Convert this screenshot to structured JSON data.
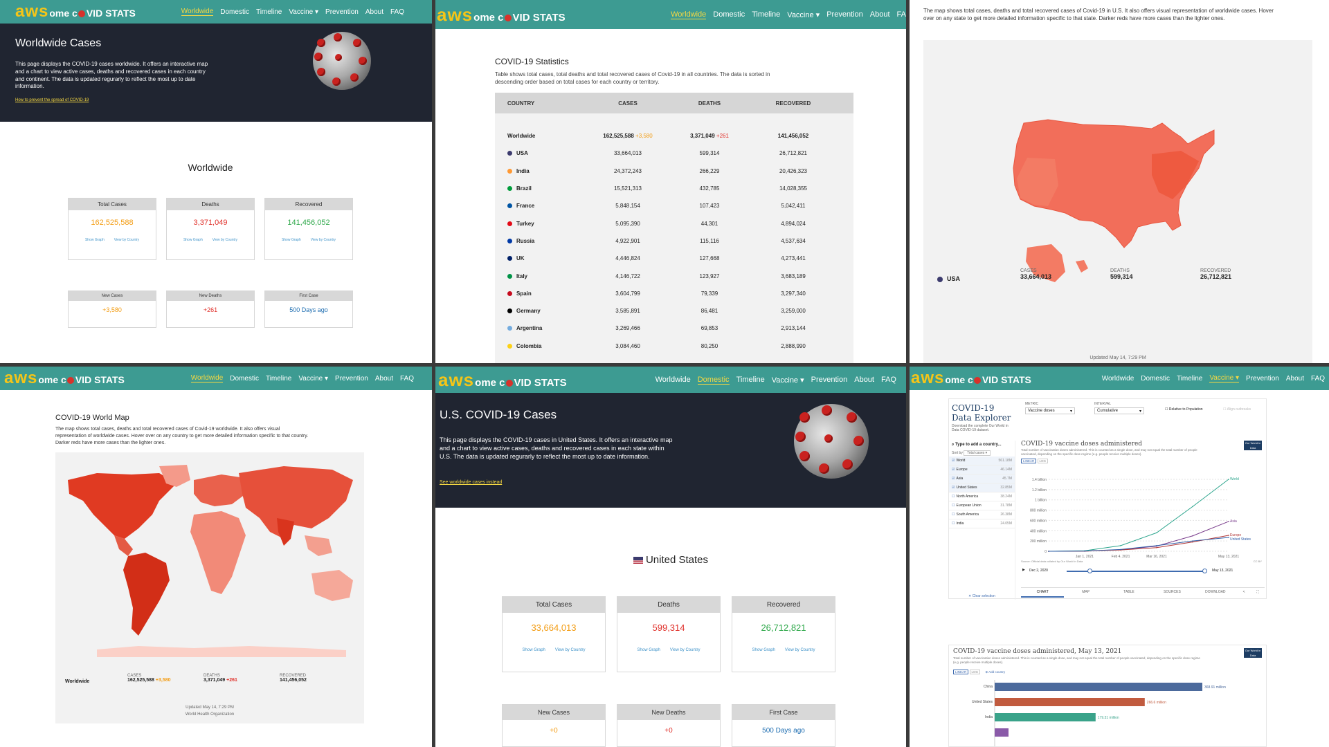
{
  "brand": {
    "aws": "aws",
    "rest_a": "ome c",
    "rest_b": "VID STATS"
  },
  "nav": {
    "worldwide": "Worldwide",
    "domestic": "Domestic",
    "timeline": "Timeline",
    "vaccine": "Vaccine",
    "prevention": "Prevention",
    "about": "About",
    "faq": "FAQ",
    "faq_cut": "FA"
  },
  "p1": {
    "title": "Worldwide Cases",
    "desc": "This page displays the COVID-19 cases worldwide. It offers an interactive map and a chart to view active cases, deaths and recovered cases in each country and continent. The data is updated regurarly to reflect the most up to date information.",
    "link": "How to prevent the spread of COVID-19",
    "section": "Worldwide",
    "cards": [
      {
        "label": "Total Cases",
        "value": "162,525,588",
        "color": "#f39c12"
      },
      {
        "label": "Deaths",
        "value": "3,371,049",
        "color": "#e0302a"
      },
      {
        "label": "Recovered",
        "value": "141,456,052",
        "color": "#2ea84a"
      }
    ],
    "show_graph": "Show Graph",
    "view_by_country": "View by Country",
    "small": [
      {
        "label": "New Cases",
        "value": "+3,580",
        "color": "#f39c12"
      },
      {
        "label": "New Deaths",
        "value": "+261",
        "color": "#e0302a"
      },
      {
        "label": "First Case",
        "value": "500 Days ago",
        "color": "#1c6cb0"
      }
    ]
  },
  "p2": {
    "title": "COVID-19 Statistics",
    "desc": "Table shows total cases, total deaths and total recovered cases of Covid-19 in all countries. The data is sorted in descending order based on total cases for each country or territory.",
    "headers": [
      "COUNTRY",
      "CASES",
      "DEATHS",
      "RECOVERED"
    ],
    "rows": [
      {
        "country": "Worldwide",
        "cases": "162,525,588",
        "cases_new": "+3,580",
        "deaths": "3,371,049",
        "deaths_new": "+261",
        "recovered": "141,456,052",
        "flag": ""
      },
      {
        "country": "USA",
        "cases": "33,664,013",
        "deaths": "599,314",
        "recovered": "26,712,821",
        "flag": "#3c3b6e"
      },
      {
        "country": "India",
        "cases": "24,372,243",
        "deaths": "266,229",
        "recovered": "20,426,323",
        "flag": "#ff9933"
      },
      {
        "country": "Brazil",
        "cases": "15,521,313",
        "deaths": "432,785",
        "recovered": "14,028,355",
        "flag": "#009c3b"
      },
      {
        "country": "France",
        "cases": "5,848,154",
        "deaths": "107,423",
        "recovered": "5,042,411",
        "flag": "#0055a4"
      },
      {
        "country": "Turkey",
        "cases": "5,095,390",
        "deaths": "44,301",
        "recovered": "4,894,024",
        "flag": "#e30a17"
      },
      {
        "country": "Russia",
        "cases": "4,922,901",
        "deaths": "115,116",
        "recovered": "4,537,634",
        "flag": "#0039a6"
      },
      {
        "country": "UK",
        "cases": "4,446,824",
        "deaths": "127,668",
        "recovered": "4,273,441",
        "flag": "#012169"
      },
      {
        "country": "Italy",
        "cases": "4,146,722",
        "deaths": "123,927",
        "recovered": "3,683,189",
        "flag": "#009246"
      },
      {
        "country": "Spain",
        "cases": "3,604,799",
        "deaths": "79,339",
        "recovered": "3,297,340",
        "flag": "#c60b1e"
      },
      {
        "country": "Germany",
        "cases": "3,585,891",
        "deaths": "86,481",
        "recovered": "3,259,000",
        "flag": "#000000"
      },
      {
        "country": "Argentina",
        "cases": "3,269,466",
        "deaths": "69,853",
        "recovered": "2,913,144",
        "flag": "#74acdf"
      },
      {
        "country": "Colombia",
        "cases": "3,084,460",
        "deaths": "80,250",
        "recovered": "2,888,990",
        "flag": "#fcd116"
      }
    ]
  },
  "p3": {
    "desc": "The map shows total cases, deaths and total recovered cases of Covid-19 in U.S. It also offers visual representation of worldwide cases. Hover over on any state to get more detailed information specific to that state. Darker reds have more cases than the lighter ones.",
    "country": "USA",
    "cases_label": "CASES",
    "cases": "33,664,013",
    "deaths_label": "DEATHS",
    "deaths": "599,314",
    "recovered_label": "RECOVERED",
    "recovered": "26,712,821",
    "updated": "Updated May 14, 7:29 PM"
  },
  "p4": {
    "title": "COVID-19 World Map",
    "desc": "The map shows total cases, deaths and total recovered cases of Covid-19 worldwide. It also offers visual representation of worldwide cases. Hover over on any country to get more detailed information specific to that country. Darker reds have more cases than the lighter ones.",
    "country": "Worldwide",
    "cases_label": "CASES",
    "cases": "162,525,588",
    "cases_new": "+3,580",
    "deaths_label": "DEATHS",
    "deaths": "3,371,049",
    "deaths_new": "+261",
    "recovered_label": "RECOVERED",
    "recovered": "141,456,052",
    "updated": "Updated May 14, 7:29 PM",
    "source": "World Health Organization"
  },
  "p5": {
    "title": "U.S. COVID-19 Cases",
    "desc": "This page displays the COVID-19 cases in United States. It offers an interactive map and a chart to view active cases, deaths and recovered cases in each state within U.S. The data is updated regurarly to reflect the most up to date information.",
    "link": "See worldwide cases instead",
    "section": "United States",
    "cards": [
      {
        "label": "Total Cases",
        "value": "33,664,013",
        "color": "#f39c12"
      },
      {
        "label": "Deaths",
        "value": "599,314",
        "color": "#e0302a"
      },
      {
        "label": "Recovered",
        "value": "26,712,821",
        "color": "#2ea84a"
      }
    ],
    "show_graph": "Show Graph",
    "view_by_country": "View by Country",
    "small": [
      {
        "label": "New Cases",
        "value": "+0",
        "color": "#f39c12"
      },
      {
        "label": "New Deaths",
        "value": "+0",
        "color": "#e0302a"
      },
      {
        "label": "First Case",
        "value": "500 Days ago",
        "color": "#1c6cb0"
      }
    ]
  },
  "p6": {
    "explorer_title_1": "COVID-19",
    "explorer_title_2": "Data Explorer",
    "explorer_sub": "Download the complete Our World in Data COVID-19 dataset.",
    "metric_label": "METRIC",
    "metric_value": "Vaccine doses",
    "interval_label": "INTERVAL",
    "interval_value": "Cumulative",
    "relative": "Relative to Population",
    "align": "Align outbreaks",
    "search_placeholder": "Type to add a country...",
    "sort_by": "Sort by",
    "sort_value": "Total cases",
    "countries": [
      {
        "name": "World",
        "value": "561.18M",
        "checked": true
      },
      {
        "name": "Europe",
        "value": "46.14M",
        "checked": true
      },
      {
        "name": "Asia",
        "value": "45.7M",
        "checked": true
      },
      {
        "name": "United States",
        "value": "32.85M",
        "checked": true
      },
      {
        "name": "North America",
        "value": "38.24M",
        "checked": false
      },
      {
        "name": "European Union",
        "value": "31.78M",
        "checked": false
      },
      {
        "name": "South America",
        "value": "26.38M",
        "checked": false
      },
      {
        "name": "India",
        "value": "24.05M",
        "checked": false
      }
    ],
    "clear": "✕ Clear selection",
    "chart_title": "COVID-19 vaccine doses administered",
    "chart_sub": "Total number of vaccination doses administered. This is counted as a single dose, and may not equal the total number of people vaccinated, depending on the specific dose regime (e.g. people receive multiple doses).",
    "owid": "Our World in Data",
    "linear": "LINEAR",
    "log": "LOG",
    "yticks": [
      "1.4 billion",
      "1.2 billion",
      "1 billion",
      "800 million",
      "600 million",
      "400 million",
      "200 million",
      "0"
    ],
    "xticks": [
      "Jan 1, 2021",
      "Feb 4, 2021",
      "Mar 16, 2021",
      "May 13, 2021"
    ],
    "source_note": "Source: Official data collated by Our World in Data",
    "cc": "CC BY",
    "start_date": "Dec 2, 2020",
    "end_date": "May 13, 2021",
    "tabs": [
      "CHART",
      "MAP",
      "TABLE",
      "SOURCES",
      "DOWNLOAD"
    ],
    "line_labels": [
      "World",
      "Asia",
      "Europe",
      "United States"
    ],
    "bar_title": "COVID-19 vaccine doses administered, May 13, 2021",
    "bar_sub": "Total number of vaccination doses administered. This is counted as a single dose, and may not equal the total number of people vaccinated, depending on the specific dose regime (e.g. people receive multiple doses).",
    "add_country": "Add country"
  },
  "chart_data": [
    {
      "type": "line",
      "title": "COVID-19 vaccine doses administered",
      "ylabel": "",
      "ylim": [
        0,
        1400000000
      ],
      "x": [
        "Dec 2, 2020",
        "Jan 1, 2021",
        "Feb 4, 2021",
        "Mar 16, 2021",
        "Apr 15, 2021",
        "May 13, 2021"
      ],
      "series": [
        {
          "name": "World",
          "values": [
            0,
            10000000,
            110000000,
            360000000,
            870000000,
            1400000000
          ],
          "color": "#2ca58d"
        },
        {
          "name": "Asia",
          "values": [
            0,
            3000000,
            30000000,
            100000000,
            300000000,
            580000000
          ],
          "color": "#7a3d8c"
        },
        {
          "name": "Europe",
          "values": [
            0,
            2000000,
            25000000,
            70000000,
            180000000,
            310000000
          ],
          "color": "#b13434"
        },
        {
          "name": "United States",
          "values": [
            0,
            3000000,
            35000000,
            110000000,
            200000000,
            270000000
          ],
          "color": "#3360a9"
        }
      ]
    },
    {
      "type": "bar",
      "title": "COVID-19 vaccine doses administered, May 13, 2021",
      "categories": [
        "China",
        "United States",
        "India"
      ],
      "values": [
        368910000,
        266600000,
        179300000
      ],
      "value_labels": [
        "368.91 million",
        "266.6 million",
        "179.31 million"
      ],
      "colors": [
        "#4c6a9c",
        "#c15b3f",
        "#3aa38a"
      ]
    }
  ]
}
